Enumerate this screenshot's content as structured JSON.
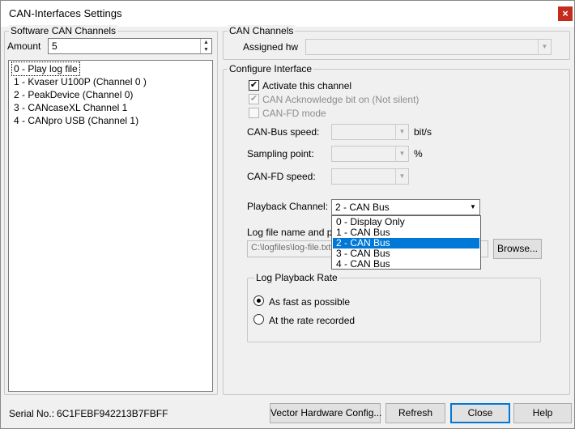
{
  "window": {
    "title": "CAN-Interfaces Settings",
    "close_glyph": "×"
  },
  "software_group": {
    "legend": "Software CAN Channels",
    "amount_label": "Amount",
    "amount_value": "5",
    "items": [
      "0 - Play log file",
      "1 - Kvaser U100P (Channel 0 )",
      "2 - PeakDevice (Channel 0)",
      "3 - CANcaseXL Channel 1",
      "4 - CANpro USB (Channel 1)"
    ]
  },
  "can_channels_group": {
    "legend": "CAN Channels",
    "assigned_label": "Assigned hw",
    "assigned_value": ""
  },
  "configure_group": {
    "legend": "Configure Interface",
    "activate": {
      "label": "Activate this channel",
      "checked": true,
      "check_glyph": "✔"
    },
    "acknowledge": {
      "label": "CAN Acknowledge bit on (Not silent)",
      "checked": true,
      "check_glyph": "✔"
    },
    "canfd_mode": {
      "label": "CAN-FD mode",
      "checked": false
    },
    "bus_speed": {
      "label": "CAN-Bus speed:",
      "unit": "bit/s",
      "value": ""
    },
    "sampling": {
      "label": "Sampling point:",
      "unit": "%",
      "value": ""
    },
    "fd_speed": {
      "label": "CAN-FD speed:",
      "value": ""
    },
    "playback": {
      "label": "Playback Channel:",
      "value": "2 - CAN Bus",
      "options": [
        "0 - Display Only",
        "1 - CAN Bus",
        "2 - CAN Bus",
        "3 - CAN Bus",
        "4 - CAN Bus"
      ],
      "selected_index": 2
    },
    "logfile": {
      "label": "Log file name and pat",
      "value": "C:\\logfiles\\log-file.txt",
      "browse_label": "Browse..."
    },
    "rate_group": {
      "legend": "Log Playback Rate",
      "fast_label": "As fast as possible",
      "recorded_label": "At the rate recorded",
      "selected": "fast"
    }
  },
  "footer": {
    "serial_label": "Serial No.:",
    "serial_value": "6C1FEBF942213B7FBFF",
    "buttons": {
      "vector": "Vector Hardware Config...",
      "refresh": "Refresh",
      "close": "Close",
      "help": "Help"
    }
  },
  "glyphs": {
    "arrow_down": "▼",
    "arrow_up": "▲"
  },
  "colors": {
    "accent": "#0078d7",
    "close_button": "#c42b1c"
  }
}
